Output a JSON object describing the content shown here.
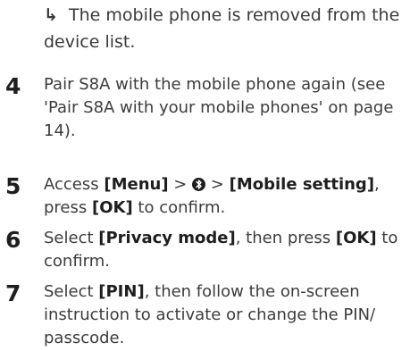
{
  "result": {
    "arrow": "↳",
    "text": "The mobile phone is removed from the device list."
  },
  "steps": [
    {
      "number": "4",
      "text": "Pair S8A with the mobile phone again (see 'Pair S8A with your mobile phones' on page 14)."
    },
    {
      "number": "5",
      "pre": "Access ",
      "menu": "[Menu]",
      "sep1": " > ",
      "icon": "bluetooth-icon",
      "sep2": " > ",
      "mobile_setting": "[Mobile setting]",
      "mid": ", press ",
      "ok": "[OK]",
      "post": " to confirm."
    },
    {
      "number": "6",
      "pre": "Select ",
      "privacy": "[Privacy mode]",
      "mid": ", then press ",
      "ok": "[OK]",
      "post": " to confirm."
    },
    {
      "number": "7",
      "pre": "Select ",
      "pin": "[PIN]",
      "post": ", then follow the on-screen instruction to activate or change the PIN/ passcode."
    }
  ]
}
